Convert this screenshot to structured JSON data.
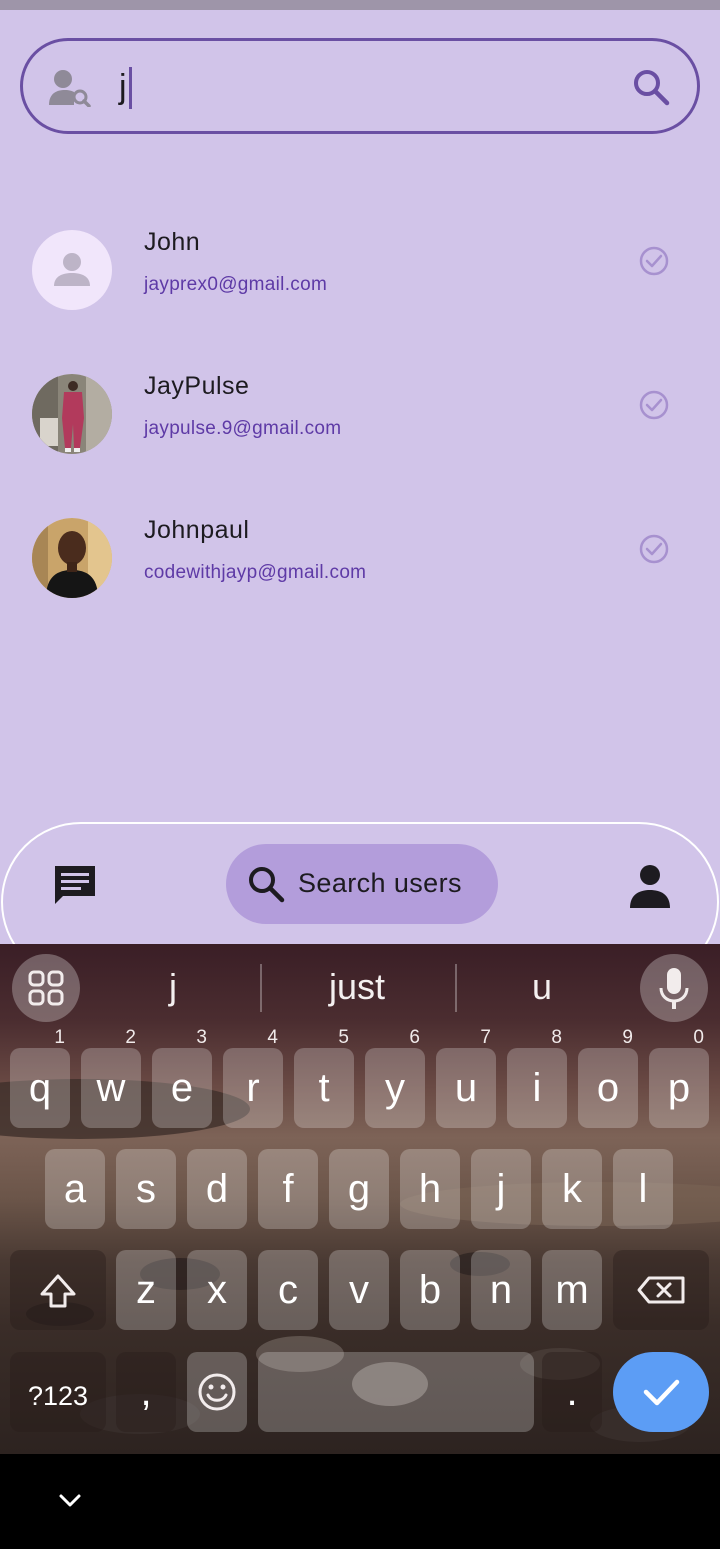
{
  "search": {
    "query": "j"
  },
  "users": [
    {
      "name": "John",
      "email": "jayprex0@gmail.com",
      "avatar": "default-avatar"
    },
    {
      "name": "JayPulse",
      "email": "jaypulse.9@gmail.com",
      "avatar": "photo-standing-person"
    },
    {
      "name": "Johnpaul",
      "email": "codewithjayp@gmail.com",
      "avatar": "photo-portrait"
    }
  ],
  "bottom_nav": {
    "search_label": "Search users"
  },
  "keyboard": {
    "suggestions": [
      "j",
      "just",
      "u"
    ],
    "row1": [
      {
        "key": "q",
        "hint": "1"
      },
      {
        "key": "w",
        "hint": "2"
      },
      {
        "key": "e",
        "hint": "3"
      },
      {
        "key": "r",
        "hint": "4"
      },
      {
        "key": "t",
        "hint": "5"
      },
      {
        "key": "y",
        "hint": "6"
      },
      {
        "key": "u",
        "hint": "7"
      },
      {
        "key": "i",
        "hint": "8"
      },
      {
        "key": "o",
        "hint": "9"
      },
      {
        "key": "p",
        "hint": "0"
      }
    ],
    "row2": [
      "a",
      "s",
      "d",
      "f",
      "g",
      "h",
      "j",
      "k",
      "l"
    ],
    "row3": [
      "z",
      "x",
      "c",
      "v",
      "b",
      "n",
      "m"
    ],
    "symbols_label": "?123",
    "comma": ",",
    "period": "."
  },
  "colors": {
    "app_background": "#d1c4e9",
    "accent": "#6a4fa3",
    "active_pill": "#b39ddb",
    "email_text": "#5e3aa6",
    "enter_key": "#5c9df5"
  }
}
